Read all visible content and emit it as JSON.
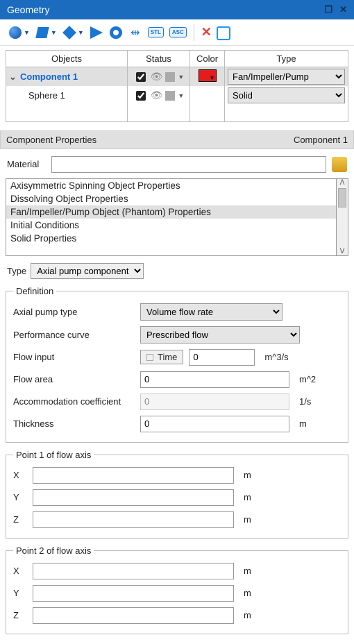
{
  "window": {
    "title": "Geometry"
  },
  "toolbar": {
    "stl_label": "STL",
    "asc_label": "ASC"
  },
  "tree": {
    "headers": {
      "objects": "Objects",
      "status": "Status",
      "color": "Color",
      "type": "Type"
    },
    "rows": [
      {
        "name": "Component 1",
        "checked": true,
        "color": "#e51c1c",
        "type": "Fan/Impeller/Pump",
        "selected": true
      },
      {
        "name": "Sphere 1",
        "checked": true,
        "color": null,
        "type": "Solid",
        "selected": false
      }
    ]
  },
  "comp_props": {
    "header": "Component Properties",
    "current": "Component 1"
  },
  "material": {
    "label": "Material",
    "value": ""
  },
  "proplist": {
    "items": [
      "Axisymmetric Spinning Object Properties",
      "Dissolving Object Properties",
      "Fan/Impeller/Pump Object (Phantom) Properties",
      "Initial Conditions",
      "Solid Properties"
    ],
    "selected": 2
  },
  "type_row": {
    "label": "Type",
    "value": "Axial pump component"
  },
  "definition": {
    "legend": "Definition",
    "axial_pump_type": {
      "label": "Axial pump type",
      "value": "Volume flow rate"
    },
    "performance_curve": {
      "label": "Performance curve",
      "value": "Prescribed flow"
    },
    "flow_input": {
      "label": "Flow input",
      "time_label": "Time",
      "value": "0",
      "unit": "m^3/s"
    },
    "flow_area": {
      "label": "Flow area",
      "value": "0",
      "unit": "m^2"
    },
    "accommodation": {
      "label": "Accommodation coefficient",
      "value": "0",
      "unit": "1/s"
    },
    "thickness": {
      "label": "Thickness",
      "value": "0",
      "unit": "m"
    }
  },
  "point1": {
    "legend": "Point 1 of flow axis",
    "x": {
      "label": "X",
      "value": "",
      "unit": "m"
    },
    "y": {
      "label": "Y",
      "value": "",
      "unit": "m"
    },
    "z": {
      "label": "Z",
      "value": "",
      "unit": "m"
    }
  },
  "point2": {
    "legend": "Point 2 of flow axis",
    "x": {
      "label": "X",
      "value": "",
      "unit": "m"
    },
    "y": {
      "label": "Y",
      "value": "",
      "unit": "m"
    },
    "z": {
      "label": "Z",
      "value": "",
      "unit": "m"
    }
  }
}
